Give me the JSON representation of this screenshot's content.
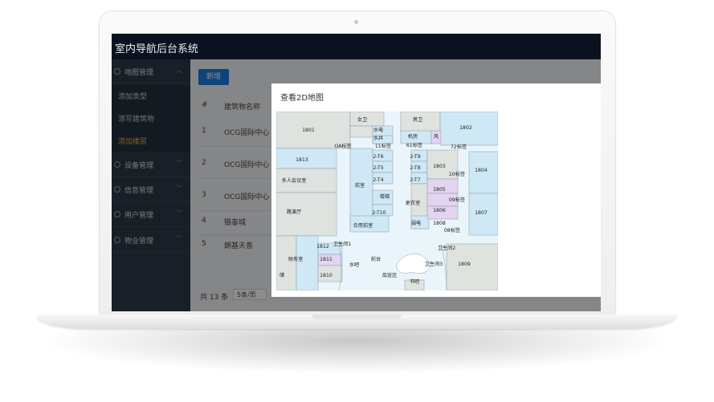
{
  "app": {
    "title": "室内导航后台系统"
  },
  "sidebar": {
    "menus": [
      {
        "label": "地图管理"
      },
      {
        "label": "设备管理"
      },
      {
        "label": "信息管理"
      },
      {
        "label": "用户管理"
      },
      {
        "label": "物业管理"
      }
    ],
    "sub_items": [
      {
        "label": "添加类型"
      },
      {
        "label": "添写建筑物"
      },
      {
        "label": "添加楼层"
      }
    ]
  },
  "main": {
    "add_button": "新增",
    "table": {
      "headers": [
        "#",
        "建筑物名称"
      ],
      "rows": [
        {
          "num": "1",
          "name": "OCG国际中心"
        },
        {
          "num": "2",
          "name": "OCG国际中心"
        },
        {
          "num": "3",
          "name": "OCG国际中心"
        },
        {
          "num": "4",
          "name": "银泰城"
        },
        {
          "num": "5",
          "name": "朗基天香"
        }
      ]
    },
    "pager": {
      "total": "共 13 条",
      "page_size": "5条/页"
    }
  },
  "dialog": {
    "title": "查看2D地图"
  },
  "map": {
    "labels": [
      "1801",
      "女卫",
      "男卫",
      "1802",
      "水电",
      "水井",
      "机房",
      "风",
      "OA标签",
      "11标签",
      "61标签",
      "72标签",
      "1813",
      "2-T6",
      "2-T9",
      "1803",
      "1804",
      "10标签",
      "2-T5",
      "2-T8",
      "多人会议室",
      "前室",
      "2-T4",
      "2-T7",
      "1805",
      "楼梯",
      "更衣室",
      "09标签",
      "1806",
      "路演厅",
      "2-T10",
      "1807",
      "合用前室",
      "弱电",
      "1808",
      "08标签",
      "1812",
      "卫生间1",
      "卫生间2",
      "财务室",
      "1811",
      "水吧",
      "前台",
      "卫生间3",
      "1809",
      "1810",
      "储",
      "品宣区",
      "书吧"
    ],
    "colors": {
      "blue": "#cfe8f6",
      "grey": "#dfe3df",
      "purple": "#e2d4f2",
      "corridor": "#e9f5fa",
      "line": "#8a9aa3"
    }
  }
}
